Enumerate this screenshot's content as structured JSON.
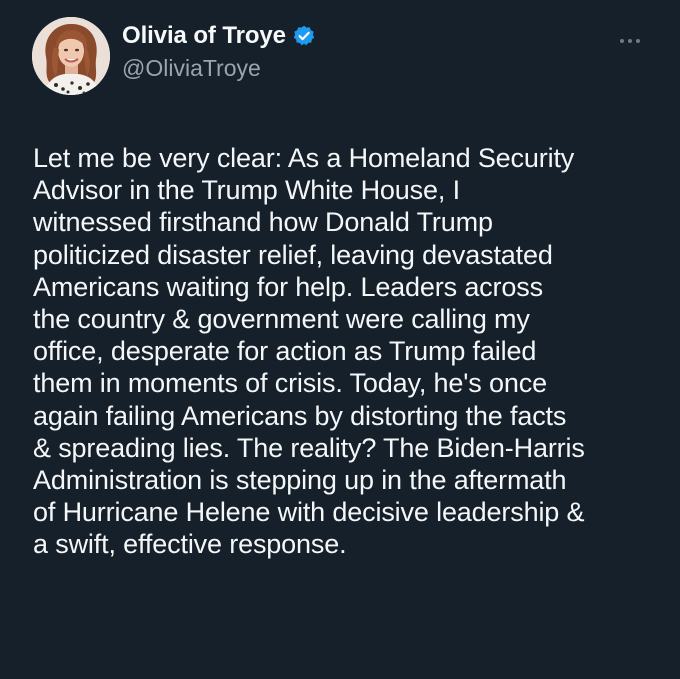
{
  "post": {
    "author": {
      "display_name": "Olivia of Troye",
      "handle": "@OliviaTroye",
      "verified": true,
      "verified_badge_icon": "verified-badge-icon",
      "avatar_icon": "profile-photo"
    },
    "more_icon": "more-options-icon",
    "body": "Let me be very clear: As a Homeland Security\nAdvisor in the Trump White House, I\nwitnessed firsthand how Donald Trump\npoliticized disaster relief, leaving devastated\nAmericans waiting for help. Leaders across\nthe country & government were calling my\noffice, desperate for action as Trump failed\nthem in moments of crisis. Today, he's once\nagain failing Americans by distorting the facts\n& spreading lies. The reality? The Biden-Harris\nAdministration is stepping up in the aftermath\nof Hurricane Helene with decisive leadership &\na swift, effective response."
  },
  "colors": {
    "background": "#15202b",
    "text": "#f7f9f9",
    "secondary_text": "#9aa4ad",
    "verified_blue": "#1d9bf0"
  }
}
